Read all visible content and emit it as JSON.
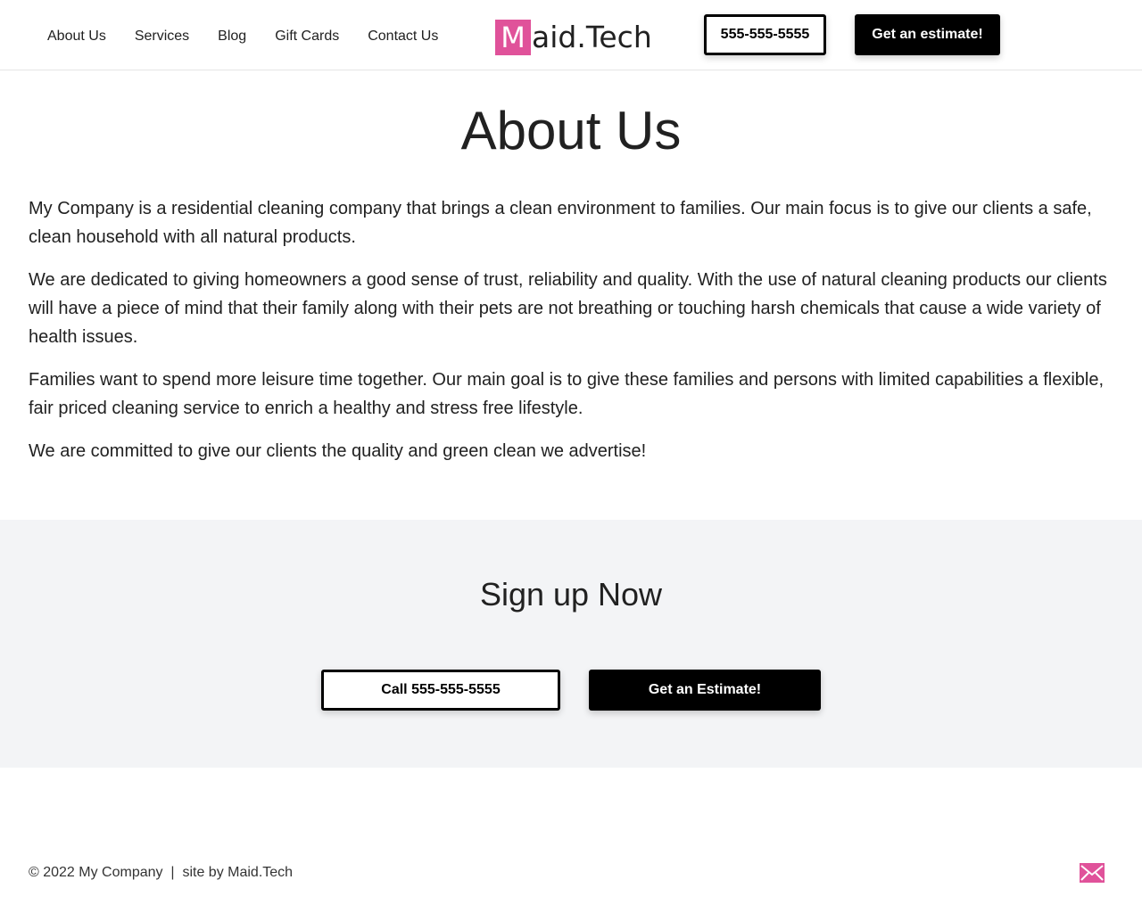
{
  "header": {
    "nav": [
      {
        "label": "About Us"
      },
      {
        "label": "Services"
      },
      {
        "label": "Blog"
      },
      {
        "label": "Gift Cards"
      },
      {
        "label": "Contact Us"
      }
    ],
    "logo": {
      "mark": "M",
      "text": "aid.Tech"
    },
    "phone_button": "555-555-5555",
    "estimate_button": "Get an estimate!"
  },
  "main": {
    "title": "About Us",
    "paragraphs": [
      "My Company is a residential cleaning company that brings a clean environment to families. Our main focus is to give our clients a safe, clean household with all natural products.",
      "We are dedicated to giving homeowners a good sense of trust, reliability and quality. With the use of natural cleaning products our clients will have a piece of mind that their family along with their pets are not breathing or touching harsh chemicals that cause a wide variety of health issues.",
      "Families want to spend more leisure time together. Our main goal is to give these families and persons with limited capabilities a flexible, fair priced cleaning service to enrich a healthy and stress free lifestyle.",
      "We are committed to give our clients the quality and green clean we advertise!"
    ]
  },
  "signup": {
    "title": "Sign up Now",
    "call_button": "Call 555-555-5555",
    "estimate_button": "Get an Estimate!"
  },
  "footer": {
    "text": "© 2022 My Company  |  site by Maid.Tech",
    "mail_icon": "envelope-icon"
  },
  "colors": {
    "brand": "#e0529a",
    "button_dark": "#000000",
    "signup_bg": "#f3f4f6"
  }
}
